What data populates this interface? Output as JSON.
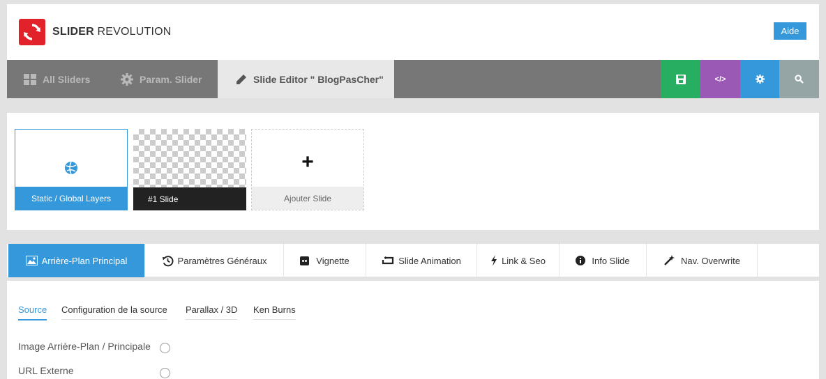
{
  "header": {
    "logo_bold": "SLIDER",
    "logo_light": "REVOLUTION",
    "help_label": "Aide"
  },
  "nav": {
    "all_sliders": "All Sliders",
    "slider_params": "Param. Slider",
    "slide_editor": "Slide Editor \" BlogPasCher\""
  },
  "toolbar": {
    "save_color": "#27ae60",
    "code_color": "#9b59b6",
    "settings_color": "#3498db",
    "search_color": "#95a5a6",
    "code_glyph": "</>"
  },
  "slides": {
    "static_label": "Static / Global Layers",
    "slide1_label": "#1 Slide",
    "add_label": "Ajouter Slide",
    "add_glyph": "+"
  },
  "tabs": {
    "main_bg": "Arrière-Plan Principal",
    "general": "Paramètres Généraux",
    "thumbnail": "Vignette",
    "animation": "Slide Animation",
    "link_seo": "Link & Seo",
    "info": "Info Slide",
    "nav_overwrite": "Nav. Overwrite"
  },
  "subtabs": {
    "source": "Source",
    "source_config": "Configuration de la source",
    "parallax": "Parallax / 3D",
    "ken_burns": "Ken Burns"
  },
  "options": {
    "image_bg": "Image Arrière-Plan / Principale",
    "external_url": "URL Externe"
  },
  "colors": {
    "accent": "#3498db",
    "logo_red": "#e2222b",
    "nav_bg": "#777777"
  }
}
